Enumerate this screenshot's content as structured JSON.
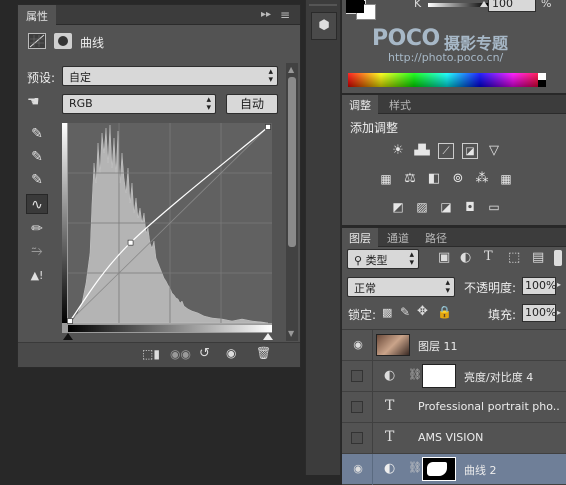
{
  "properties_panel": {
    "tab_label": "属性",
    "expand_glyph": "▸▸",
    "menu_glyph": "≡",
    "title": "曲线",
    "preset_label": "预设:",
    "preset_value": "自定",
    "channel_value": "RGB",
    "auto_button": "自动",
    "curve_points": [
      [
        0,
        0
      ],
      [
        78,
        103
      ],
      [
        255,
        255
      ]
    ],
    "footer_icons": [
      "clip-to-layer-icon",
      "view-previous-icon",
      "reset-icon",
      "visibility-icon",
      "delete-icon"
    ]
  },
  "watermark": {
    "brand_poco": "POCO",
    "brand_cn": "摄影专题",
    "url": "http://photo.poco.cn/"
  },
  "color_panel": {
    "k_label": "K",
    "k_value": "100",
    "unit": "%"
  },
  "adjustments_panel": {
    "tabs": [
      "调整",
      "样式"
    ],
    "heading": "添加调整",
    "icons_row1": [
      "brightness-icon",
      "levels-icon",
      "curves-icon",
      "exposure-icon",
      "vibrance-icon"
    ],
    "icons_row2": [
      "hue-saturation-icon",
      "color-balance-icon",
      "black-white-icon",
      "photo-filter-icon",
      "channel-mixer-icon",
      "color-lookup-icon"
    ],
    "icons_row3": [
      "invert-icon",
      "posterize-icon",
      "threshold-icon",
      "selective-color-icon",
      "gradient-map-icon"
    ]
  },
  "layers_panel": {
    "tabs": [
      "图层",
      "通道",
      "路径"
    ],
    "filter_kind": "类型",
    "blend_mode": "正常",
    "opacity_label": "不透明度:",
    "opacity_value": "100%",
    "lock_label": "锁定:",
    "fill_label": "填充:",
    "fill_value": "100%",
    "layers": [
      {
        "name": "图层 11",
        "type": "image",
        "visible": true
      },
      {
        "name": "亮度/对比度 4",
        "type": "adjustment",
        "visible": false
      },
      {
        "name": "Professional portrait pho...",
        "type": "text",
        "visible": false
      },
      {
        "name": "AMS VISION",
        "type": "text",
        "visible": false
      },
      {
        "name": "曲线 2",
        "type": "adjustment",
        "visible": true,
        "selected": true
      }
    ]
  }
}
